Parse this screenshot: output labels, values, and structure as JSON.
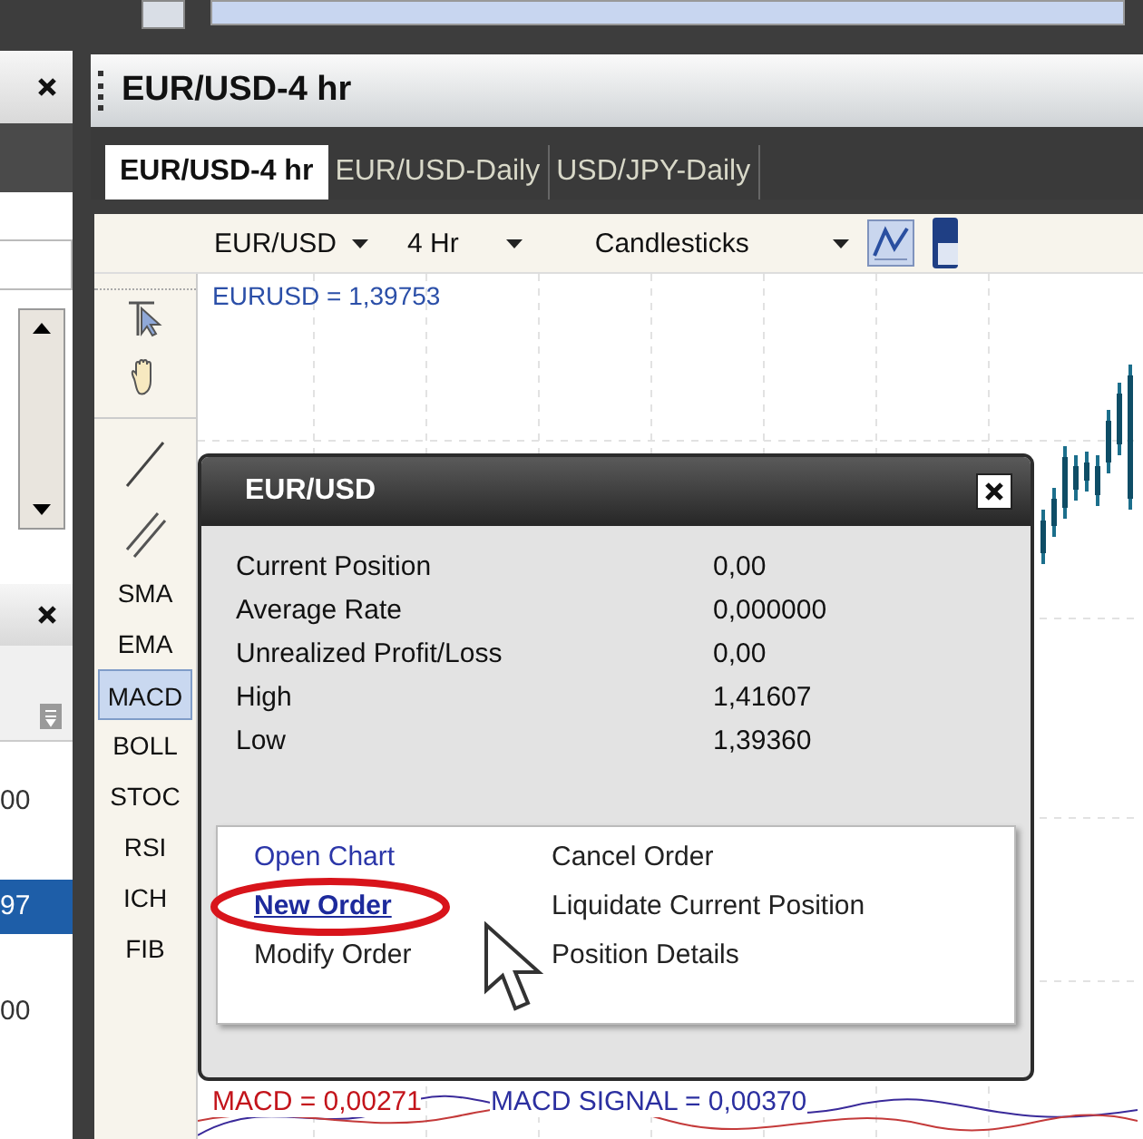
{
  "side_panel": {
    "cells": [
      {
        "text": "00",
        "selected": false
      },
      {
        "text": "97",
        "selected": true
      },
      {
        "text": "00",
        "selected": false
      }
    ]
  },
  "window": {
    "title": "EUR/USD-4 hr"
  },
  "tabs": [
    {
      "label": "EUR/USD-4 hr",
      "selected": true
    },
    {
      "label": "EUR/USD-Daily",
      "selected": false
    },
    {
      "label": "USD/JPY-Daily",
      "selected": false
    }
  ],
  "toolbar": {
    "symbol": "EUR/USD",
    "period": "4 Hr",
    "chart_type": "Candlesticks"
  },
  "indicators": [
    {
      "label": "SMA",
      "selected": false
    },
    {
      "label": "EMA",
      "selected": false
    },
    {
      "label": "MACD",
      "selected": true
    },
    {
      "label": "BOLL",
      "selected": false
    },
    {
      "label": "STOC",
      "selected": false
    },
    {
      "label": "RSI",
      "selected": false
    },
    {
      "label": "ICH",
      "selected": false
    },
    {
      "label": "FIB",
      "selected": false
    }
  ],
  "chart": {
    "price_label": "EURUSD = 1,39753",
    "macd_label": "MACD = 0,00271",
    "signal_label": "MACD SIGNAL = 0,00370"
  },
  "popup": {
    "title": "EUR/USD",
    "rows": [
      {
        "label": "Current Position",
        "value": "0,00"
      },
      {
        "label": "Average Rate",
        "value": "0,000000"
      },
      {
        "label": "Unrealized Profit/Loss",
        "value": "0,00"
      },
      {
        "label": "High",
        "value": "1,41607"
      },
      {
        "label": "Low",
        "value": "1,39360"
      }
    ],
    "actions_left": [
      {
        "label": "Open Chart",
        "kind": "link",
        "highlighted": false
      },
      {
        "label": "New Order",
        "kind": "link",
        "highlighted": true
      },
      {
        "label": "Modify Order",
        "kind": "command",
        "highlighted": false
      }
    ],
    "actions_right": [
      {
        "label": "Cancel Order",
        "kind": "command",
        "highlighted": false
      },
      {
        "label": "Liquidate Current Position",
        "kind": "command",
        "highlighted": false
      },
      {
        "label": "Position Details",
        "kind": "command",
        "highlighted": false
      }
    ]
  }
}
